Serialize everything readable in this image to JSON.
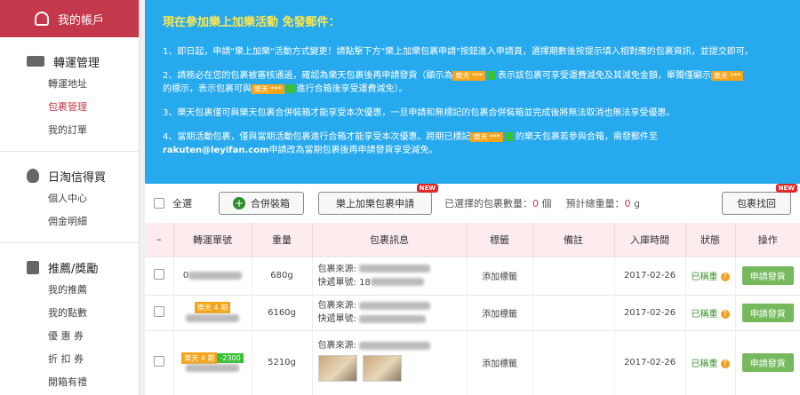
{
  "sidebar": {
    "account_title": "我的帳戶",
    "sections": [
      {
        "title": "轉運管理",
        "icon": "truck-icon",
        "items": [
          "轉運地址",
          "包裹管理",
          "我的訂單"
        ],
        "active": 1
      },
      {
        "title": "日淘信得買",
        "icon": "money-bag-icon",
        "items": [
          "個人中心",
          "佣金明細"
        ],
        "active": -1
      },
      {
        "title": "推薦/獎勵",
        "icon": "gift-box-icon",
        "items": [
          "我的推薦",
          "我的點數",
          "優 惠 券",
          "折 扣 券",
          "開箱有禮"
        ],
        "active": -1
      }
    ]
  },
  "notice": {
    "title": "現在參加樂上加樂活動 免發郵件：",
    "p1": "1、即日起，申請\"樂上加樂\"活動方式變更！請點擊下方\"樂上加樂包裹申請\"按鈕進入申請頁，選擇期數後按提示填入相對應的包裹資訊，並提交即可。",
    "p2a": "2、請務必在您的包裹被審核通過，確認為樂天包裹後再申請發貨（顯示為",
    "p2b": "表示該包裹可享受運費減免及其減免金額，單獨僅顯示",
    "p2c": "的標示，表示包裹可與",
    "p2d": "進行合箱後享受運費減免）。",
    "tag": "樂天 ***",
    "p3": "3、樂天包裹僅可與樂天包裹合併裝箱才能享受本次優惠，一旦申請和無標記的包裹合併裝箱並完成後將無法取消也無法享受優惠。",
    "p4a": "4、當期活動包裹，僅與當期活動包裹進行合箱才能享受本次優惠。跨期已標記",
    "p4b": "的樂天包裹若參與合箱，需發郵件至",
    "email": "rakuten@leyifan.com",
    "p4c": "申請改為當期包裹後再申請發貨享受減免。"
  },
  "toolbar": {
    "select_all": "全選",
    "merge_button": "合併裝箱",
    "apply_button": "樂上加樂包裹申請",
    "new_badge": "NEW",
    "selected_label": "已選擇的包裹數量：",
    "selected_count": "0",
    "selected_unit": "個",
    "weight_label": "預計總重量：",
    "weight_value": "0",
    "weight_unit": "g",
    "find_button": "包裹找回"
  },
  "table": {
    "headers": [
      "–",
      "轉運單號",
      "重量",
      "包裹訊息",
      "標籤",
      "備註",
      "入庫時間",
      "狀態",
      "操作"
    ],
    "source_label": "包裹來源:",
    "tracking_label": "快遞單號:",
    "rows": [
      {
        "tracking": "0",
        "weight": "680g",
        "tracking_no_partial": "18",
        "tag_action": "添加標籤",
        "date": "2017-02-26",
        "status": "已稱重",
        "action": "申請發貨"
      },
      {
        "tracking_tag": "樂天 4 期",
        "weight": "6160g",
        "tag_action": "添加標籤",
        "date": "2017-02-26",
        "status": "已稱重",
        "action": "申請發貨"
      },
      {
        "tracking_tag": "樂天 4 期",
        "tracking_tag2": "-2300",
        "weight": "5210g",
        "tag_action": "添加標籤",
        "date": "2017-02-26",
        "status": "已稱重",
        "action": "申請發貨"
      }
    ]
  }
}
